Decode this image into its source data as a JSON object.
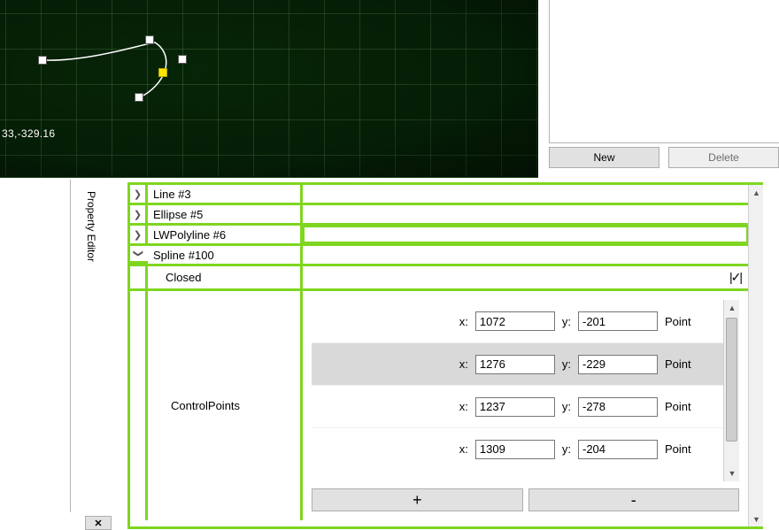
{
  "canvas": {
    "cursor_readout": "33,-329.16"
  },
  "side_panel": {
    "new_label": "New",
    "delete_label": "Delete"
  },
  "property_editor": {
    "title": "Property Editor",
    "tree": [
      {
        "label": "Line #3",
        "expanded": false
      },
      {
        "label": "Ellipse #5",
        "expanded": false
      },
      {
        "label": "LWPolyline #6",
        "expanded": false,
        "selected": true
      },
      {
        "label": "Spline #100",
        "expanded": true
      }
    ],
    "spline": {
      "closed": {
        "label": "Closed",
        "checked": true
      },
      "control_points": {
        "label": "ControlPoints",
        "x_label": "x:",
        "y_label": "y:",
        "kind_label": "Point",
        "points": [
          {
            "x": "1072",
            "y": "-201",
            "selected": false
          },
          {
            "x": "1276",
            "y": "-229",
            "selected": true
          },
          {
            "x": "1237",
            "y": "-278",
            "selected": false
          },
          {
            "x": "1309",
            "y": "-204",
            "selected": false
          }
        ],
        "add_label": "+",
        "remove_label": "-"
      }
    }
  },
  "left_btn_glyph": "✕"
}
